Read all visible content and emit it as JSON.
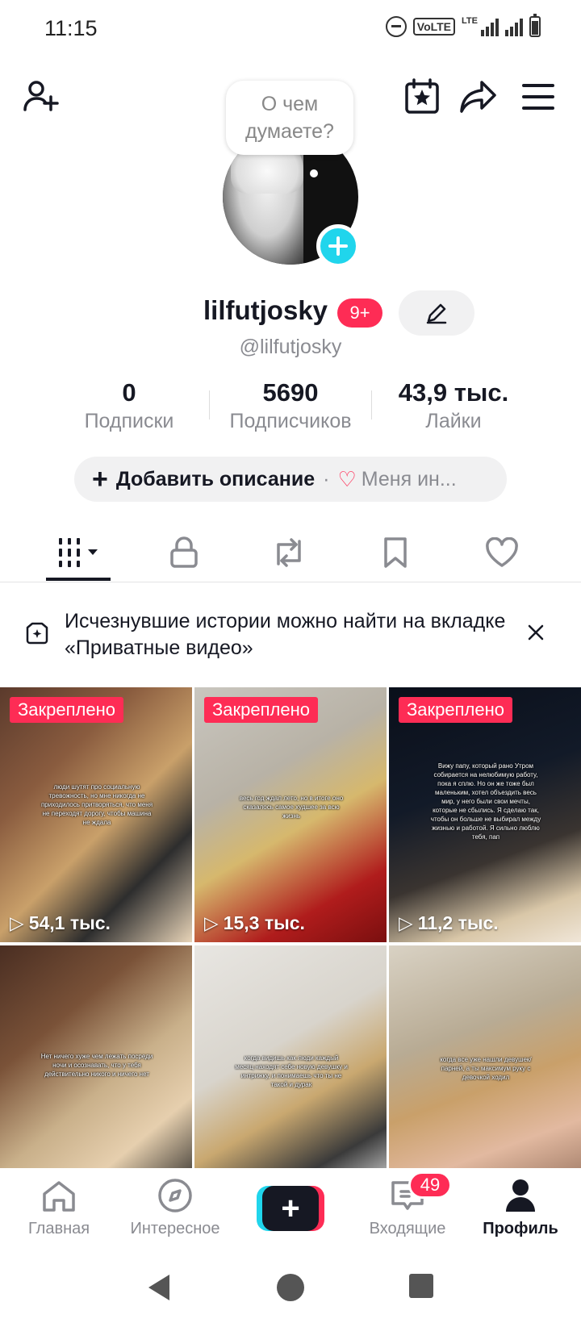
{
  "status_bar": {
    "time": "11:15",
    "volte": "VoLTE",
    "lte": "LTE"
  },
  "header": {
    "add_friend_icon": "add-user-icon",
    "calendar_icon": "calendar-star-icon",
    "share_icon": "share-icon",
    "menu_icon": "menu-icon"
  },
  "profile": {
    "thought_bubble": "О чем думаете?",
    "username": "lilfutjosky",
    "notif_badge": "9+",
    "handle": "@lilfutjosky",
    "stats": [
      {
        "value": "0",
        "label": "Подписки"
      },
      {
        "value": "5690",
        "label": "Подписчиков"
      },
      {
        "value": "43,9 тыс.",
        "label": "Лайки"
      }
    ],
    "bio": {
      "plus": "+",
      "add_label": "Добавить описание",
      "separator": "·",
      "likes_label": "Меня ин..."
    }
  },
  "tabs": [
    {
      "icon": "grid-icon",
      "active": true
    },
    {
      "icon": "lock-icon"
    },
    {
      "icon": "repost-icon"
    },
    {
      "icon": "bookmark-icon"
    },
    {
      "icon": "heart-icon"
    }
  ],
  "notice": {
    "text": "Исчезнувшие истории можно найти на вкладке «Приватные видео»"
  },
  "videos": [
    {
      "pinned": "Закреплено",
      "views": "54,1 тыс.",
      "caption": "люди шутят про социальную тревожность, но мне никогда не приходилось притворяться, что меня не переходят дорогу, чтобы машина не ждала",
      "bg": "linear-gradient(135deg,#5b3a2c 0%,#8a5c3f 30%,#c9a06a 55%,#2d2d2d 75%,#e8d4b8 100%)"
    },
    {
      "pinned": "Закреплено",
      "views": "15,3 тыс.",
      "caption": "весь год ждал лето, но в итоге оно сказалось самое худшее за всю жизнь",
      "bg": "linear-gradient(150deg,#c9c6bf 0%,#b8b2a6 35%,#d6b86d 55%,#b01c1c 80%,#7a0f0f 100%)"
    },
    {
      "pinned": "Закреплено",
      "views": "11,2 тыс.",
      "caption": "Вижу папу, который рано Утром собирается на нелюбимую работу, пока я сплю. Но он же тоже был маленьким, хотел объездить весь мир, у него были свои мечты, которые не сбылись. Я сделаю так, чтобы он больше не выбирал между жизнью и работой. Я сильно люблю тебя, пап",
      "bg": "linear-gradient(160deg,#0a0f1a 0%,#121a28 40%,#3a3430 65%,#d9c7a8 85%,#f0e6d8 100%)"
    },
    {
      "views": "",
      "caption": "Нет ничего хуже чем лежать посреди ночи и осознавать, что у тебя действительно никого и ничего нет",
      "bg": "linear-gradient(140deg,#4a2e22 0%,#7a5238 30%,#c9b08a 55%,#e6cfae 75%,#1e1e1e 100%)"
    },
    {
      "views": "",
      "caption": "когда видишь как люди каждый месяц находят себе новую девушку и интрижку, и понимаешь что ты не такой и дурак",
      "bg": "linear-gradient(150deg,#e8e6e2 0%,#d8d4cc 40%,#c9a870 60%,#3a3a3a 80%,#f2f2f2 100%)"
    },
    {
      "views": "",
      "caption": "когда все уже нашли девушек/парней, а ты максимум руку с девочкой ходил",
      "bg": "linear-gradient(160deg,#d9d2c4 0%,#b8ab94 35%,#c9a06a 55%,#e2b9a0 75%,#8f6b58 100%)"
    }
  ],
  "bottom_nav": [
    {
      "label": "Главная",
      "icon": "home-icon"
    },
    {
      "label": "Интересное",
      "icon": "compass-icon"
    },
    {
      "label": "+",
      "icon": "create-icon"
    },
    {
      "label": "Входящие",
      "icon": "inbox-icon",
      "badge": "49"
    },
    {
      "label": "Профиль",
      "icon": "profile-icon",
      "active": true
    }
  ],
  "colors": {
    "accent": "#fe2c55",
    "cyan": "#20d5ec",
    "text": "#161823",
    "muted": "#8a8b91"
  }
}
